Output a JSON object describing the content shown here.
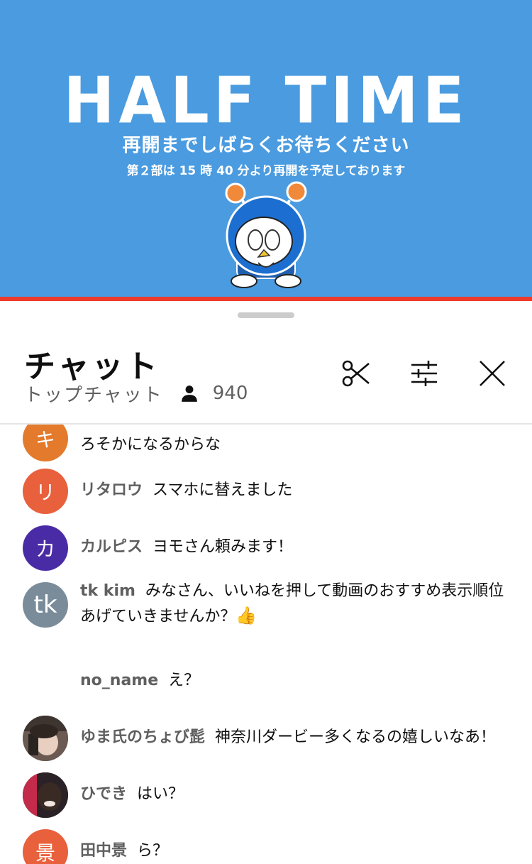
{
  "video": {
    "banner_title": "HALF TIME",
    "banner_subtitle": "再開までしばらくお待ちください",
    "banner_note": "第２部は 15 時 40 分より再開を予定しております",
    "progress_percent": 100,
    "colors": {
      "background": "#4a9be0",
      "progress": "#ef3b2c"
    }
  },
  "chat": {
    "title": "チャット",
    "mode": "トップチャット",
    "viewer_count": "940",
    "icons": {
      "clip": "scissors-icon",
      "filter": "sliders-icon",
      "close": "close-icon",
      "viewers": "person-icon"
    }
  },
  "messages": [
    {
      "avatar_text": "キ",
      "avatar_color": "#e37a2c",
      "author": "",
      "text": "ろそかになるからな"
    },
    {
      "avatar_text": "リ",
      "avatar_color": "#e8603c",
      "author": "リタロウ",
      "text": "スマホに替えました"
    },
    {
      "avatar_text": "カ",
      "avatar_color": "#4a2ba6",
      "author": "カルピス",
      "text": "ヨモさん頼みます！"
    },
    {
      "avatar_text": "tk",
      "avatar_color": "#7a8c99",
      "author": "tk kim",
      "text": "みなさん、いいねを押して動画のおすすめ表示順位あげていきませんか？",
      "emoji": "👍"
    },
    {
      "avatar_text": "",
      "avatar_color": "",
      "author": "no_name",
      "text": "え？"
    },
    {
      "avatar_text": "",
      "avatar_color": "#6b5a52",
      "author": "ゆま氏のちょび髭",
      "text": "神奈川ダービー多くなるの嬉しいなあ！"
    },
    {
      "avatar_text": "",
      "avatar_color": "#2a2226",
      "author": "ひでき",
      "text": "はい？"
    },
    {
      "avatar_text": "景",
      "avatar_color": "#e8603c",
      "author": "田中景",
      "text": "ら？"
    }
  ]
}
